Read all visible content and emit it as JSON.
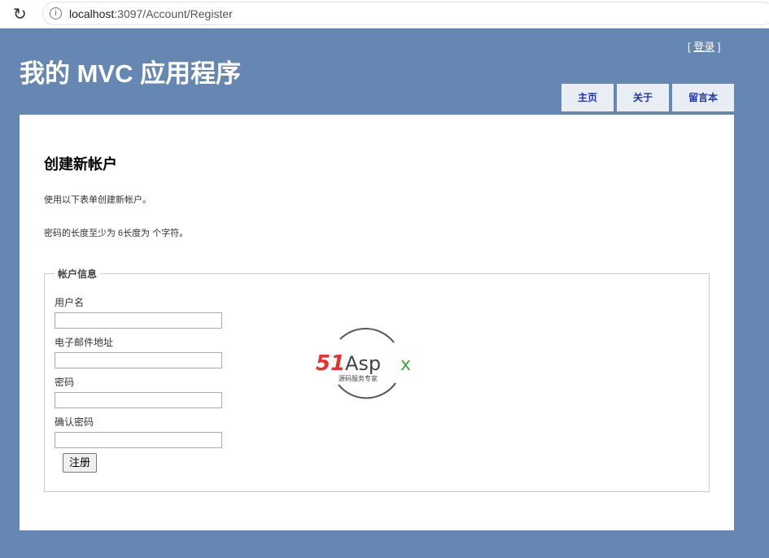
{
  "browser": {
    "url_host": "localhost",
    "url_rest": ":3097/Account/Register"
  },
  "header": {
    "title": "我的 MVC 应用程序",
    "login_open": "[ ",
    "login_link": "登录",
    "login_close": " ]",
    "nav": [
      {
        "label": "主页"
      },
      {
        "label": "关于"
      },
      {
        "label": "留言本"
      }
    ]
  },
  "main": {
    "heading": "创建新帐户",
    "intro": "使用以下表单创建新帐户。",
    "password_note": "密码的长度至少为 6长度为 个字符。",
    "fieldset_legend": "帐户信息",
    "fields": [
      {
        "label": "用户名",
        "value": ""
      },
      {
        "label": "电子邮件地址",
        "value": ""
      },
      {
        "label": "密码",
        "value": ""
      },
      {
        "label": "确认密码",
        "value": ""
      }
    ],
    "submit_label": "注册"
  },
  "watermark": {
    "brand": "51Aspx",
    "tagline": "源码服务专家",
    "colors": {
      "red": "#e8312f",
      "green": "#3aaa35",
      "gray": "#444444"
    }
  }
}
